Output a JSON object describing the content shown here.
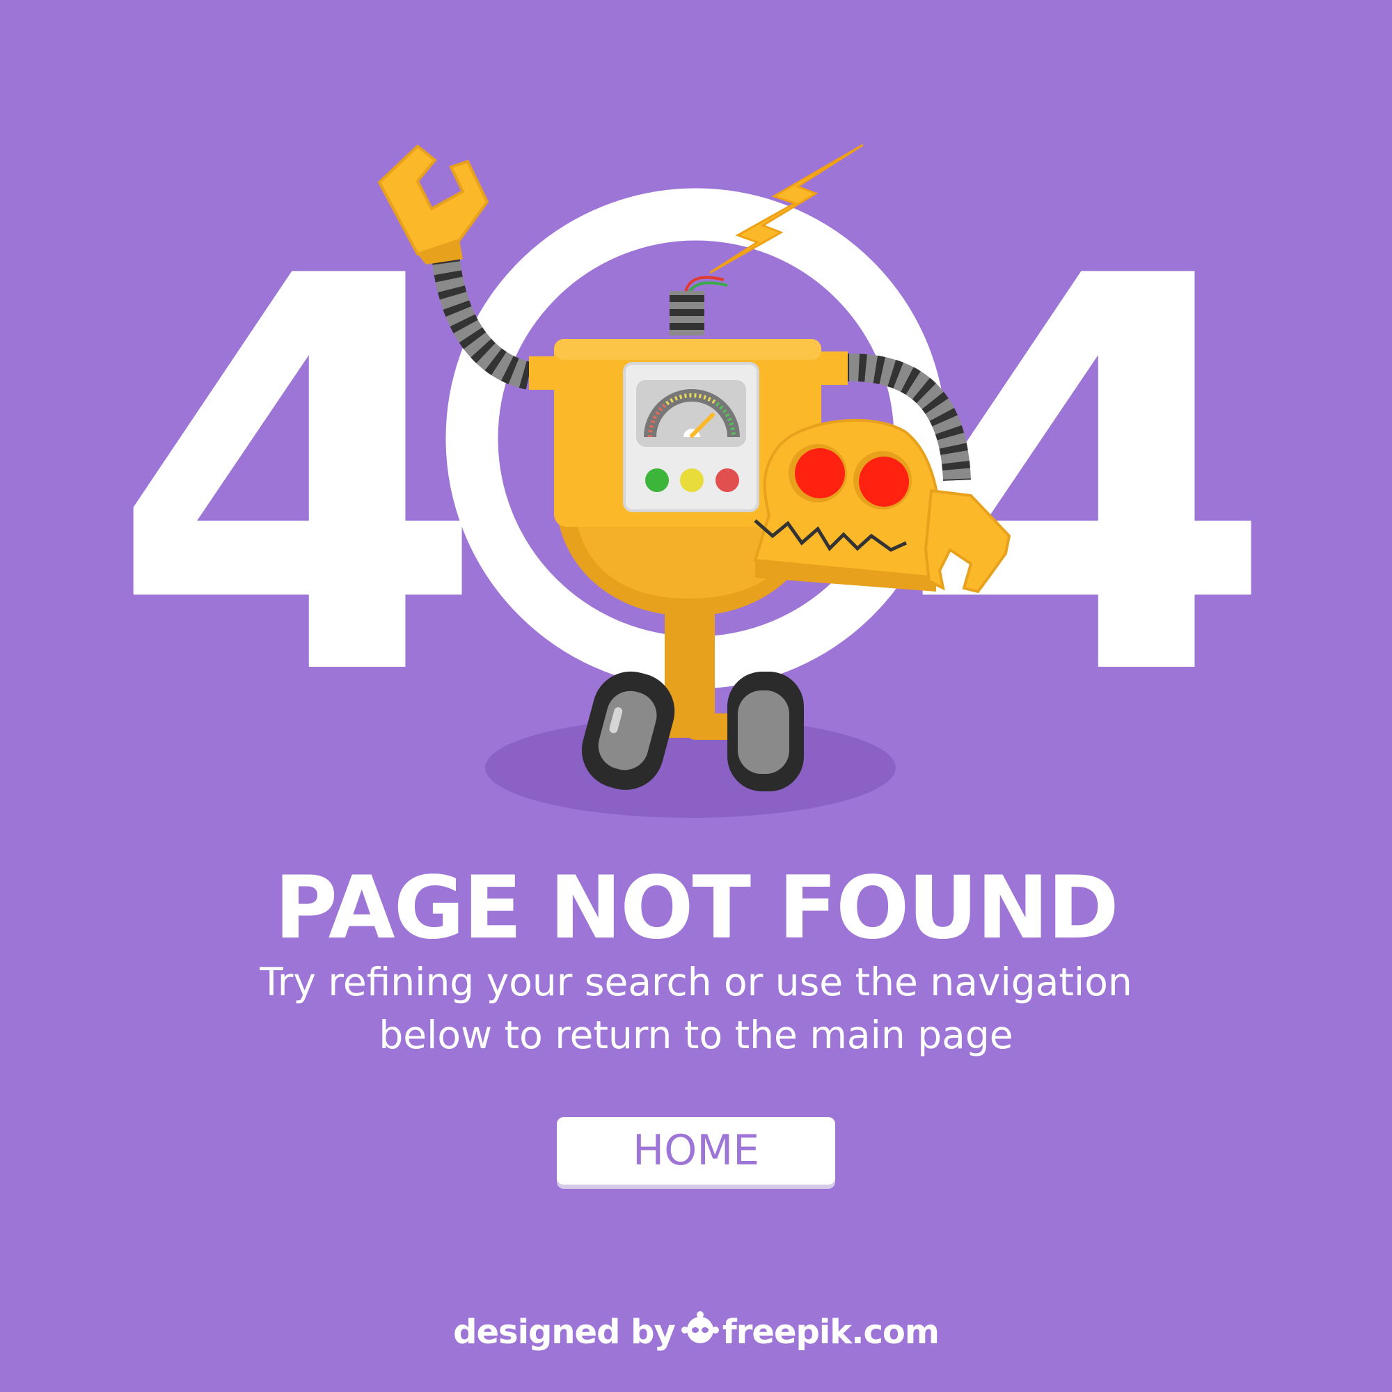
{
  "hero": {
    "digit_left": "4",
    "digit_right": "4",
    "colors": {
      "background": "#9d75d7",
      "robot_body": "#fbb92a",
      "robot_body_shade": "#e8a11c",
      "eyes": "#ff2211",
      "white": "#ffffff"
    }
  },
  "message": {
    "title": "PAGE NOT FOUND",
    "line1": "Try refining your search or use the navigation",
    "line2": "below to return to the main page"
  },
  "navigation": {
    "home_label": "HOME"
  },
  "footer": {
    "designed_by": "designed by",
    "brand": "freepik.com"
  },
  "icons": {
    "robot": "broken-robot-illustration",
    "lightning": "lightning-bolt-icon",
    "freepik_logo": "freepik-logo-icon"
  }
}
